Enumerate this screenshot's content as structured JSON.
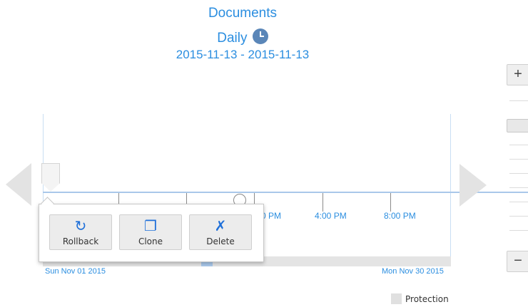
{
  "header": {
    "title": "Documents",
    "period": "Daily",
    "period_icon": "clock-icon",
    "range_start": "2015-11-13",
    "range_separator": " - ",
    "range_end": "2015-11-13"
  },
  "timeline": {
    "tick_labels": [
      "0 PM",
      "4:00 PM",
      "8:00 PM"
    ],
    "start_label": "Sun Nov 01 2015",
    "end_label": "Mon Nov 30 2015"
  },
  "popup": {
    "actions": [
      {
        "label": "Rollback",
        "icon": "rollback-icon",
        "glyph": "↻"
      },
      {
        "label": "Clone",
        "icon": "clone-icon",
        "glyph": "❐"
      },
      {
        "label": "Delete",
        "icon": "delete-icon",
        "glyph": "✗"
      }
    ]
  },
  "zoom": {
    "in_label": "+",
    "out_label": "−"
  },
  "legend": {
    "items": [
      {
        "label": "Protection",
        "color": "#e0e0e0"
      }
    ]
  },
  "colors": {
    "accent": "#2b8ee0",
    "icon_blue": "#1e6fd9"
  }
}
